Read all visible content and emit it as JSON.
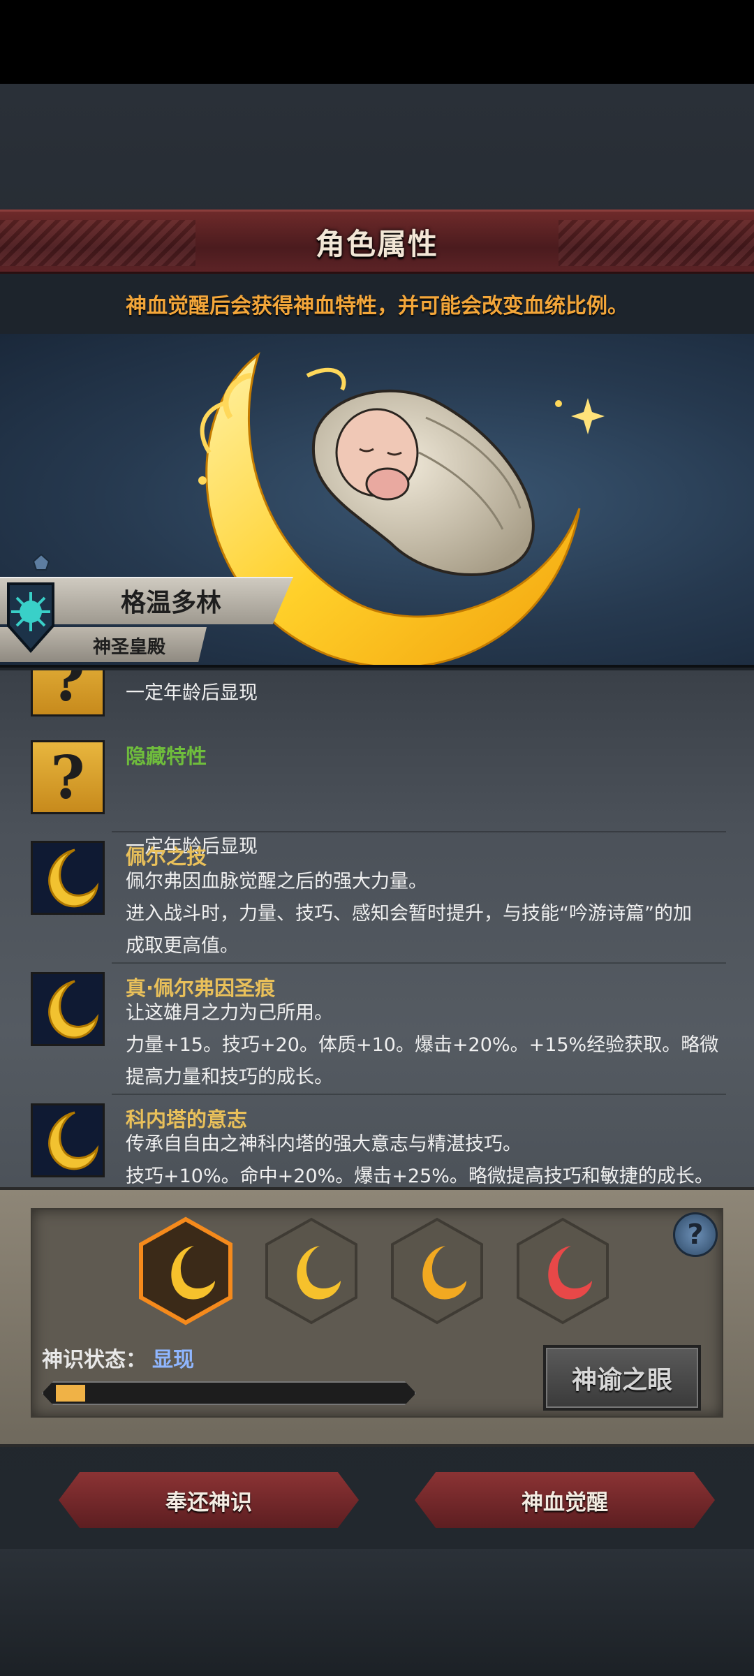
{
  "header": {
    "title": "角色属性",
    "subtitle": "神血觉醒后会获得神血特性，并可能会改变血统比例。"
  },
  "character": {
    "name": "格温多林",
    "faction": "神圣皇殿"
  },
  "traits": [
    {
      "icon": "question-icon",
      "name": "",
      "desc": "一定年龄后显现"
    },
    {
      "icon": "question-icon",
      "name": "隐藏特性",
      "desc": "一定年龄后显现"
    },
    {
      "icon": "crescent-moon-icon",
      "name": "佩尔之技",
      "desc_lines": [
        "佩尔弗因血脉觉醒之后的强大力量。",
        "进入战斗时，力量、技巧、感知会暂时提升，与技能“吟游诗篇”的加",
        "成取更高值。"
      ]
    },
    {
      "icon": "crescent-moon-icon",
      "name": "真·佩尔弗因圣痕",
      "desc_lines": [
        "让这雄月之力为己所用。",
        "力量+15。技巧+20。体质+10。爆击+20%。+15%经验获取。略微",
        "提高力量和技巧的成长。"
      ]
    },
    {
      "icon": "crescent-moon-icon",
      "name": "科内塔的意志",
      "desc_lines": [
        "传承自自由之神科内塔的强大意志与精湛技巧。",
        "技巧+10%。命中+20%。爆击+25%。略微提高技巧和敏捷的成长。"
      ]
    }
  ],
  "god_sense": {
    "label": "神识状态：",
    "value": "显现",
    "progress": 0.08,
    "help": "?",
    "oracle_button": "神谕之眼"
  },
  "actions": {
    "return_label": "奉还神识",
    "awaken_label": "神血觉醒"
  },
  "colors": {
    "banner": "#5c2326",
    "subtitle": "#f3a63a",
    "trait_name": "#e9c05a",
    "hidden_trait": "#6fbd3c",
    "sense_value": "#8fb6ff"
  }
}
